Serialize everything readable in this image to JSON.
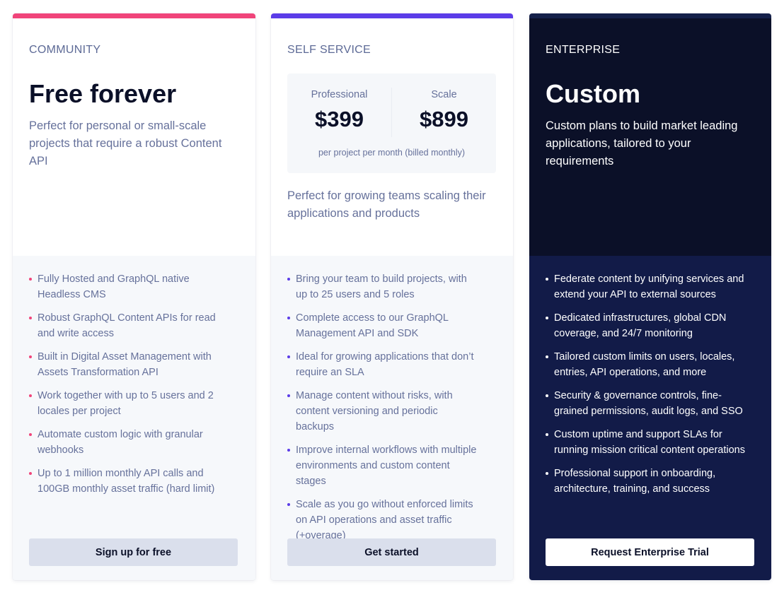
{
  "colors": {
    "community_accent": "#f0447a",
    "self_service_accent": "#5b3ce8",
    "enterprise_accent": "#15204a",
    "enterprise_bg": "#0b1028",
    "enterprise_features_bg": "#121b48"
  },
  "plans": [
    {
      "tier": "COMMUNITY",
      "title": "Free forever",
      "description": "Perfect for personal or small-scale projects that require a robust Content API",
      "features": [
        "Fully Hosted and GraphQL native Headless CMS",
        "Robust GraphQL Content APIs for read and write access",
        "Built in Digital Asset Management with Assets Transformation API",
        "Work together with up to 5 users and 2 locales per project",
        "Automate custom logic with granular webhooks",
        "Up to 1 million monthly API calls and 100GB monthly asset traffic (hard limit)"
      ],
      "cta": "Sign up for free"
    },
    {
      "tier": "SELF SERVICE",
      "pricing": {
        "options": [
          {
            "label": "Professional",
            "price": "$399"
          },
          {
            "label": "Scale",
            "price": "$899"
          }
        ],
        "note": "per project per month (billed monthly)"
      },
      "description": "Perfect for growing teams scaling their applications and products",
      "features": [
        "Bring your team to build projects, with up to 25 users and 5 roles",
        "Complete access to our GraphQL Management API and SDK",
        "Ideal for growing applications that don’t require an SLA",
        "Manage content without risks, with content versioning and periodic backups",
        "Improve internal workflows with multiple environments and custom content stages",
        "Scale as you go without enforced limits on API operations and asset traffic (+overage)"
      ],
      "cta": "Get started"
    },
    {
      "tier": "ENTERPRISE",
      "title": "Custom",
      "description": "Custom plans to build market leading applications, tailored to your requirements",
      "features": [
        "Federate content by unifying services and extend your API to external sources",
        "Dedicated infrastructures, global CDN coverage, and 24/7 monitoring",
        "Tailored custom limits on users, locales, entries, API operations, and more",
        "Security & governance controls, fine-grained permissions, audit logs, and SSO",
        "Custom uptime and support SLAs for running mission critical content operations",
        "Professional support in onboarding, architecture, training, and success"
      ],
      "cta": "Request Enterprise Trial"
    }
  ]
}
